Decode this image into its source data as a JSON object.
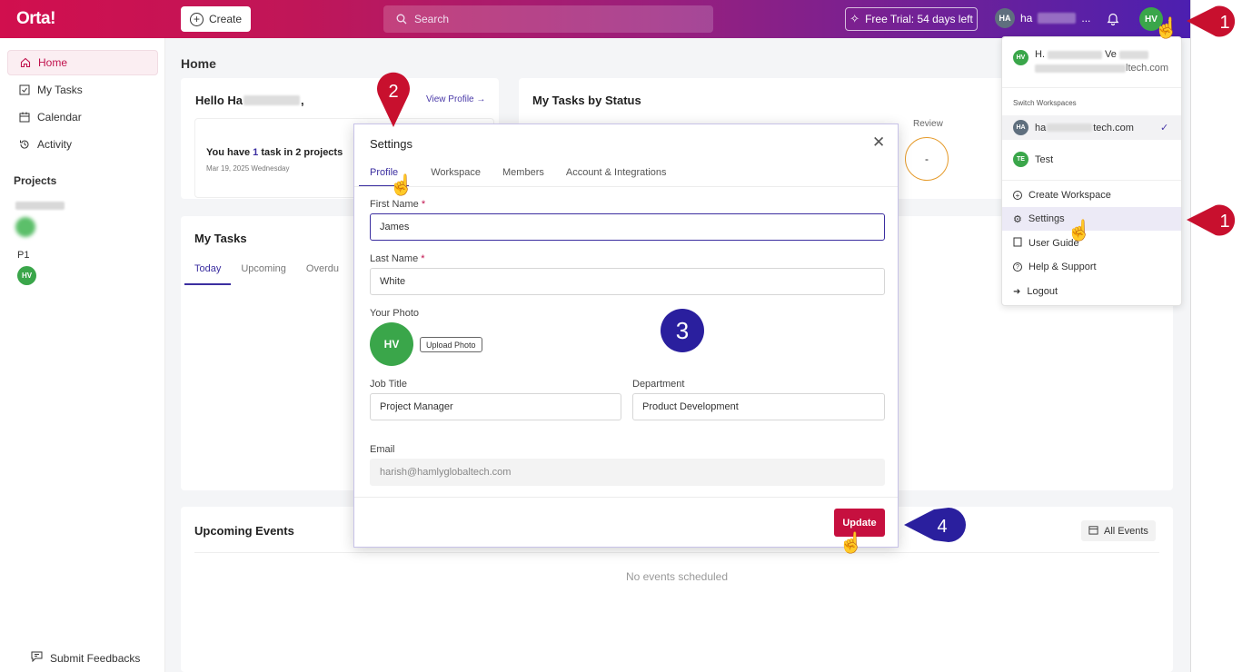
{
  "header": {
    "logo": "Orta!",
    "create_label": "Create",
    "search_placeholder": "Search",
    "trial_label": "Free Trial: 54 days left",
    "workspace_initials": "HA",
    "workspace_name": "ha",
    "workspace_ellipsis": "...",
    "user_initials": "HV"
  },
  "sidebar": {
    "items": [
      {
        "label": "Home"
      },
      {
        "label": "My Tasks"
      },
      {
        "label": "Calendar"
      },
      {
        "label": "Activity"
      }
    ],
    "projects_heading": "Projects",
    "project_p1": "P1",
    "project_p1_avatar": "HV",
    "feedback_label": "Submit Feedbacks"
  },
  "main": {
    "page_title": "Home",
    "hello_prefix": "Hello Ha",
    "hello_suffix": ",",
    "view_profile": "View Profile →",
    "task_summary_a": "You have ",
    "task_summary_count": "1",
    "task_summary_b": " task in 2 projects",
    "task_date": "Mar 19, 2025 Wednesday",
    "status_title": "My Tasks by Status",
    "status_review_label": "Review",
    "status_review_value": "-",
    "mytasks_title": "My Tasks",
    "mytasks_tabs": [
      "Today",
      "Upcoming",
      "Overdu"
    ],
    "events_title": "Upcoming Events",
    "all_events": "All Events",
    "no_events": "No events scheduled"
  },
  "dropdown": {
    "user_initials": "HV",
    "user_name_a": "H.",
    "user_name_b": "Ve",
    "user_email_tail": "ltech.com",
    "switch_heading": "Switch Workspaces",
    "workspaces": [
      {
        "initials": "HA",
        "name_a": "ha",
        "name_b": "tech.com",
        "checked": true
      },
      {
        "initials": "TE",
        "name_a": "Test",
        "name_b": "",
        "checked": false
      }
    ],
    "actions": [
      "Create Workspace",
      "Settings",
      "User Guide",
      "Help & Support",
      "Logout"
    ]
  },
  "modal": {
    "title": "Settings",
    "tabs": [
      "Profile",
      "Workspace",
      "Members",
      "Account & Integrations"
    ],
    "first_name_label": "First Name",
    "first_name": "James",
    "last_name_label": "Last Name",
    "last_name": "White",
    "photo_label": "Your Photo",
    "photo_initials": "HV",
    "upload_label": "Upload Photo",
    "job_title_label": "Job Title",
    "job_title": "Project Manager",
    "department_label": "Department",
    "department": "Product Development",
    "email_label": "Email",
    "email": "harish@hamlyglobaltech.com",
    "update_label": "Update",
    "required_mark": "*"
  },
  "markers": {
    "step_1": "1",
    "step_2": "2",
    "step_3": "3",
    "step_4": "4"
  },
  "colors": {
    "brand": "#c6103f",
    "accent": "#3b2ea0",
    "marker_red": "#c8102e",
    "marker_blue": "#2a1f9e",
    "avatar_green": "#3aa64a"
  }
}
